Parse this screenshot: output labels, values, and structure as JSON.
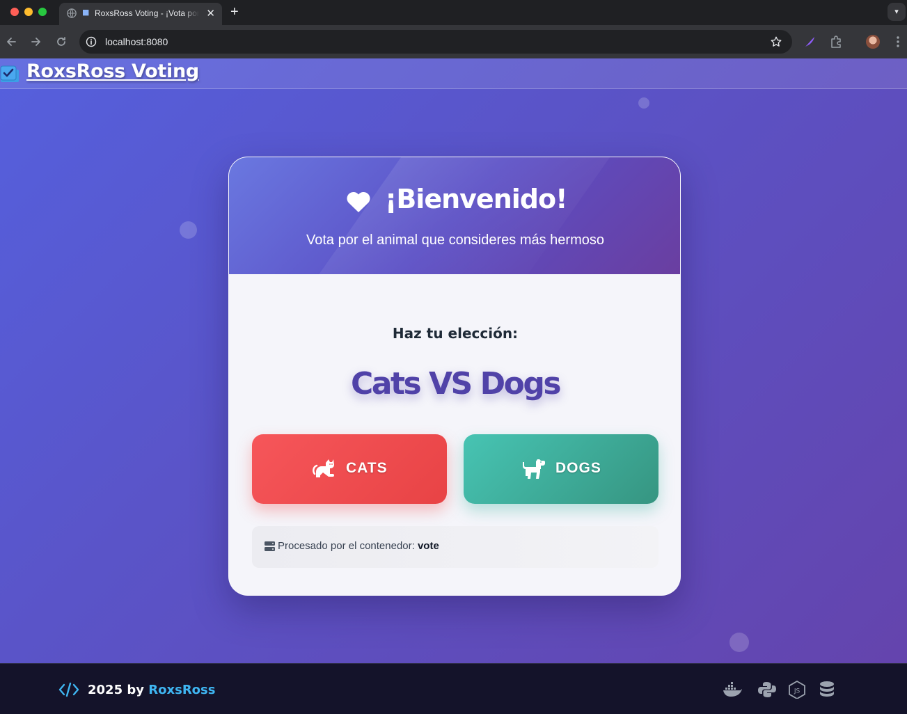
{
  "browser": {
    "tab_title": "RoxsRoss Voting - ¡Vota por",
    "tab_favicon": "ballot-box",
    "url": "localhost:8080"
  },
  "navbar": {
    "brand": "RoxsRoss Voting",
    "brand_icon": "ballot-check-icon"
  },
  "card": {
    "title": "¡Bienvenido!",
    "subtitle": "Vota por el animal que consideres más hermoso",
    "prompt": "Haz tu elección:",
    "matchup": "Cats VS Dogs",
    "options": [
      {
        "label": "CATS",
        "icon": "cat-icon",
        "color": "#f04e50"
      },
      {
        "label": "DOGS",
        "icon": "dog-icon",
        "color": "#3fae9c"
      }
    ],
    "processed_label": "Procesado por el contenedor:",
    "container_name": "vote"
  },
  "footer": {
    "year_text": "2025 by",
    "author": "RoxsRoss",
    "tech_icons": [
      "docker-icon",
      "python-icon",
      "nodejs-icon",
      "database-icon"
    ]
  },
  "colors": {
    "gradient_start": "#5560dd",
    "gradient_end": "#6444ad",
    "accent": "#5042a8",
    "footer_bg": "#14132a",
    "footer_brand": "#3fb6f2"
  }
}
